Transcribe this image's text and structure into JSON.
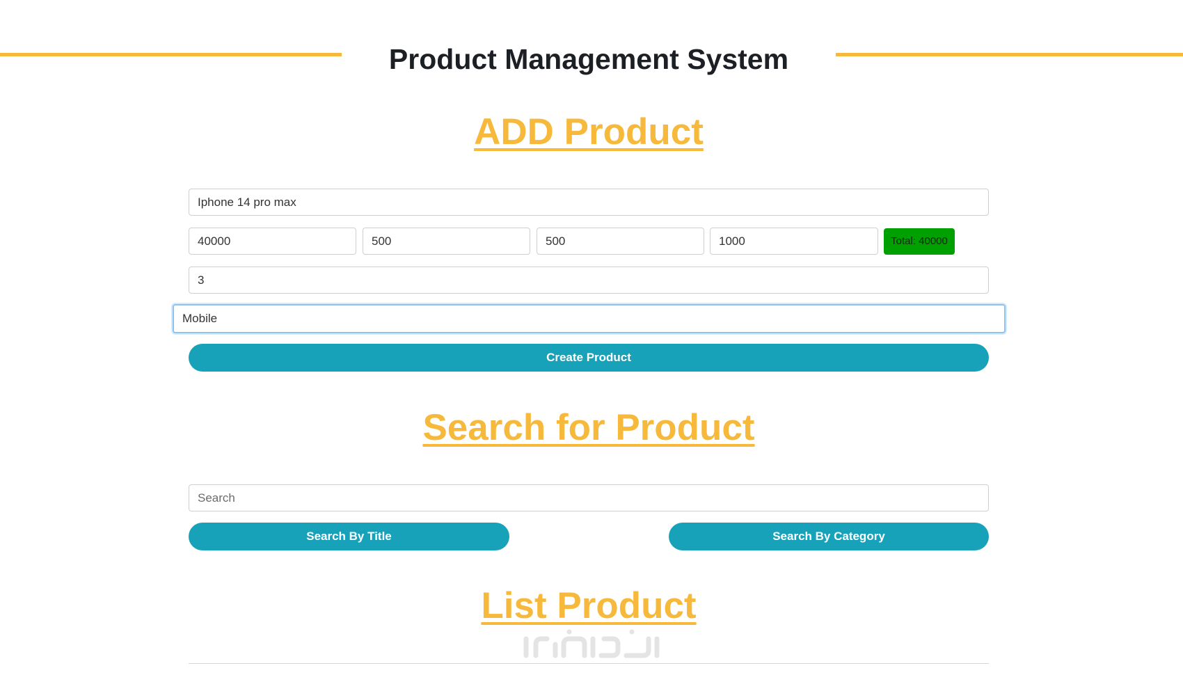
{
  "header": {
    "title": "Product Management System"
  },
  "add_section": {
    "heading": "ADD Product",
    "title_value": "Iphone 14 pro max",
    "price_value": "40000",
    "taxes_value": "500",
    "ads_value": "500",
    "discount_value": "1000",
    "total_label": "Total: 40000",
    "count_value": "3",
    "category_value": "Mobile",
    "create_button": "Create Product"
  },
  "search_section": {
    "heading": "Search for Product",
    "search_placeholder": "Search",
    "by_title_button": "Search By Title",
    "by_category_button": "Search By Category"
  },
  "list_section": {
    "heading": "List Product"
  },
  "colors": {
    "accent": "#f6b93b",
    "button": "#18a2ba",
    "total_badge": "#00a000",
    "title_text": "#1c1f24"
  }
}
